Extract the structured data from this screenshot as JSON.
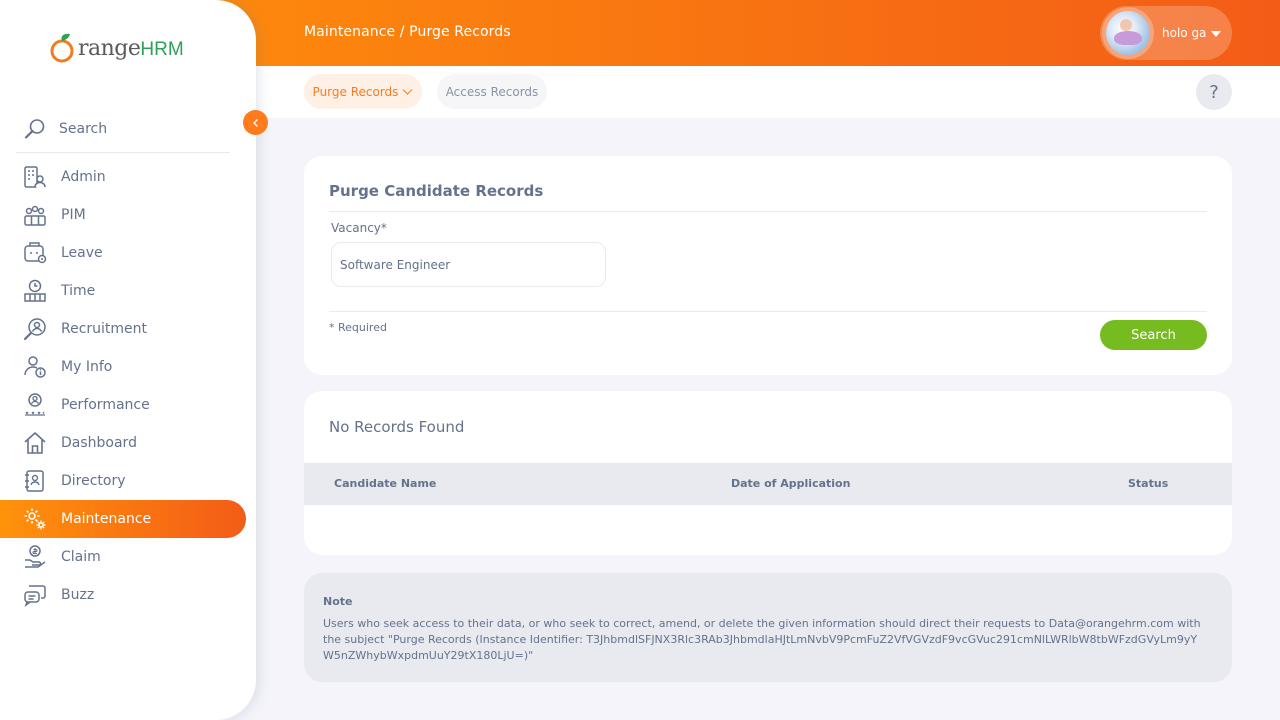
{
  "header": {
    "breadcrumb": "Maintenance / Purge Records",
    "user_name": "holo ga"
  },
  "brand": {
    "part1": "range",
    "part2": "HRM"
  },
  "sidebar": {
    "search_label": "Search",
    "items": [
      {
        "label": "Admin",
        "icon": "admin-icon",
        "active": false
      },
      {
        "label": "PIM",
        "icon": "pim-icon",
        "active": false
      },
      {
        "label": "Leave",
        "icon": "leave-icon",
        "active": false
      },
      {
        "label": "Time",
        "icon": "time-icon",
        "active": false
      },
      {
        "label": "Recruitment",
        "icon": "recruitment-icon",
        "active": false
      },
      {
        "label": "My Info",
        "icon": "my-info-icon",
        "active": false
      },
      {
        "label": "Performance",
        "icon": "performance-icon",
        "active": false
      },
      {
        "label": "Dashboard",
        "icon": "dashboard-icon",
        "active": false
      },
      {
        "label": "Directory",
        "icon": "directory-icon",
        "active": false
      },
      {
        "label": "Maintenance",
        "icon": "maintenance-icon",
        "active": true
      },
      {
        "label": "Claim",
        "icon": "claim-icon",
        "active": false
      },
      {
        "label": "Buzz",
        "icon": "buzz-icon",
        "active": false
      }
    ]
  },
  "subnav": {
    "tabs": [
      {
        "label": "Purge Records",
        "active": true
      },
      {
        "label": "Access Records",
        "active": false
      }
    ],
    "help": "?"
  },
  "purge_form": {
    "title": "Purge Candidate Records",
    "vacancy_label": "Vacancy*",
    "vacancy_value": "Software Engineer",
    "required_note": "* Required",
    "search_button": "Search"
  },
  "results": {
    "message": "No Records Found",
    "columns": [
      "Candidate Name",
      "Date of Application",
      "Status"
    ]
  },
  "note": {
    "title": "Note",
    "text": "Users who seek access to their data, or who seek to correct, amend, or delete the given information should direct their requests to Data@orangehrm.com with the subject \"Purge Records (Instance Identifier: T3JhbmdlSFJNX3Rlc3RAb3JhbmdlaHJtLmNvbV9PcmFuZ2VfVGVzdF9vcGVuc291cmNlLWRlbW8tbWFzdGVyLm9yYW5nZWhybWxpdmUuY29tX180LjU=)\""
  },
  "colors": {
    "accent": "#ff7b1d",
    "gradient_start": "#ff920b",
    "gradient_end": "#f35c17",
    "search_button": "#76bc21",
    "text": "#64728c"
  }
}
